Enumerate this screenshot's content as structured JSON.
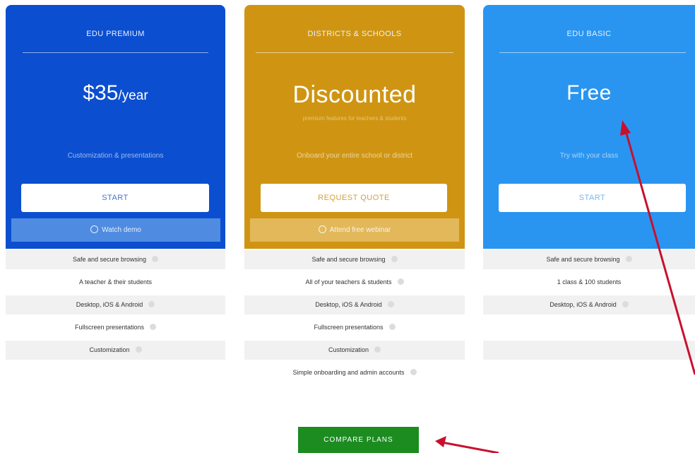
{
  "plans": [
    {
      "title": "EDU PREMIUM",
      "price": "$35",
      "price_unit": "/year",
      "description": "Customization & presentations",
      "cta": "START",
      "secondary": "Watch demo",
      "colors": {
        "card": "#0b4fd0",
        "secondary_bg": "#4f8ce1",
        "cta_text": "#4a76c8"
      },
      "features": [
        {
          "label": "Safe and secure browsing",
          "info": true
        },
        {
          "label": "A teacher & their students",
          "info": false
        },
        {
          "label": "Desktop, iOS & Android",
          "info": true
        },
        {
          "label": "Fullscreen presentations",
          "info": true
        },
        {
          "label": "Customization",
          "info": true
        }
      ]
    },
    {
      "title": "DISTRICTS & SCHOOLS",
      "price": "Discounted",
      "price_sub": "premium features for teachers & students",
      "description": "Onboard your entire school or district",
      "cta": "REQUEST QUOTE",
      "secondary": "Attend free webinar",
      "colors": {
        "card": "#cf9512",
        "secondary_bg": "#e2b85b",
        "cta_text": "#d4a13a"
      },
      "features": [
        {
          "label": "Safe and secure browsing",
          "info": true
        },
        {
          "label": "All of your teachers & students",
          "info": true
        },
        {
          "label": "Desktop, iOS & Android",
          "info": true
        },
        {
          "label": "Fullscreen presentations",
          "info": true
        },
        {
          "label": "Customization",
          "info": true
        },
        {
          "label": "Simple onboarding and admin accounts",
          "info": true
        }
      ]
    },
    {
      "title": "EDU BASIC",
      "price": "Free",
      "description": "Try with your class",
      "cta": "START",
      "colors": {
        "card": "#2995f0",
        "cta_text": "#7ab6ef"
      },
      "features": [
        {
          "label": "Safe and secure browsing",
          "info": true
        },
        {
          "label": "1 class & 100 students",
          "info": false
        },
        {
          "label": "Desktop, iOS & Android",
          "info": true
        }
      ]
    }
  ],
  "compare_button": "COMPARE PLANS",
  "annotation_color": "#c8102e",
  "icons": {
    "play": "play-circle-icon",
    "info": "info-icon",
    "arrow": "annotation-arrow-icon"
  }
}
